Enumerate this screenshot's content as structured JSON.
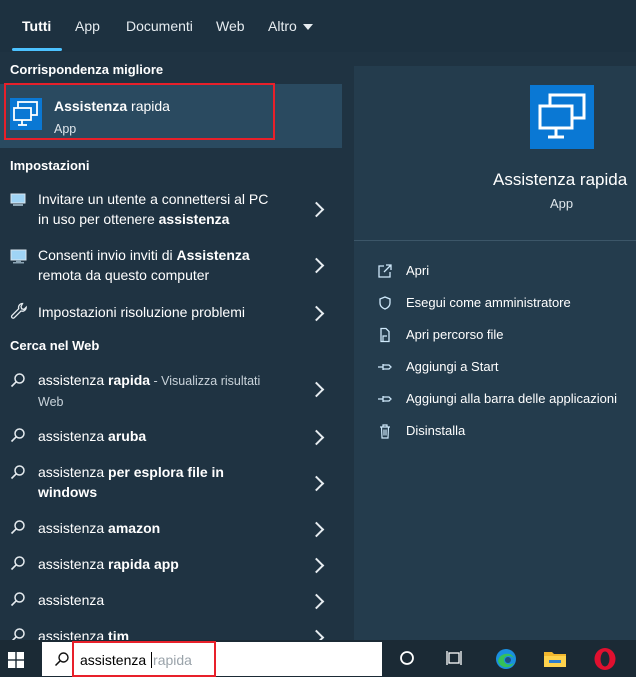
{
  "tabs": [
    {
      "label": "Tutti"
    },
    {
      "label": "App"
    },
    {
      "label": "Documenti"
    },
    {
      "label": "Web"
    },
    {
      "label": "Altro"
    }
  ],
  "best_match": {
    "section": "Corrispondenza migliore",
    "title_bold": "Assistenza",
    "title_rest": " rapida",
    "subtitle": "App"
  },
  "settings": {
    "section": "Impostazioni",
    "items": [
      {
        "line1": "Invitare un utente a connettersi al PC",
        "line2_pre": "in uso per ottenere ",
        "line2_bold": "assistenza"
      },
      {
        "line1_pre": "Consenti invio inviti di ",
        "line1_bold": "Assistenza",
        "line2": "remota da questo computer"
      },
      {
        "text": "Impostazioni risoluzione problemi"
      }
    ]
  },
  "web": {
    "section": "Cerca nel Web",
    "items": [
      {
        "pre": "assistenza ",
        "bold": "rapida",
        "suffix": " - Visualizza risultati",
        "line2": "Web"
      },
      {
        "pre": "assistenza ",
        "bold": "aruba"
      },
      {
        "pre": "assistenza ",
        "bold": "per esplora file in",
        "line2_bold": "windows"
      },
      {
        "pre": "assistenza ",
        "bold": "amazon"
      },
      {
        "pre": "assistenza ",
        "bold": "rapida app"
      },
      {
        "pre": "assistenza",
        "bold": ""
      },
      {
        "pre": "assistenza ",
        "bold": "tim"
      }
    ]
  },
  "details": {
    "app_name": "Assistenza rapida",
    "app_type": "App",
    "actions": [
      {
        "label": "Apri",
        "icon": "open-icon"
      },
      {
        "label": "Esegui come amministratore",
        "icon": "shield-icon"
      },
      {
        "label": "Apri percorso file",
        "icon": "file-location-icon"
      },
      {
        "label": "Aggiungi a Start",
        "icon": "pin-icon"
      },
      {
        "label": "Aggiungi alla barra delle applicazioni",
        "icon": "pin-icon"
      },
      {
        "label": "Disinstalla",
        "icon": "trash-icon"
      }
    ]
  },
  "search": {
    "typed": "assistenza",
    "suggestion": "rapida"
  },
  "colors": {
    "accent": "#4cc2ff",
    "app_icon": "#0a78d4",
    "highlight_frame": "#e8202a"
  }
}
